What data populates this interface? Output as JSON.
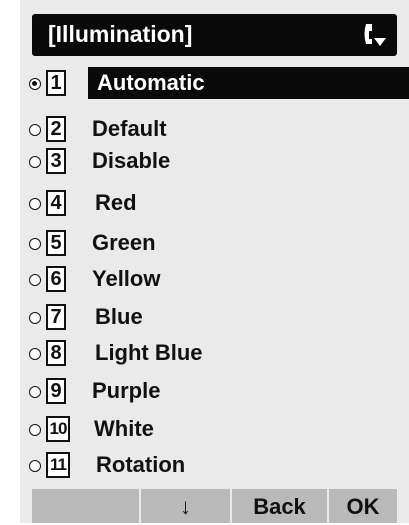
{
  "header": {
    "title": "[Illumination]",
    "icon": "handset-down-arrow-icon"
  },
  "menu": {
    "items": [
      {
        "number": "1",
        "label": "Automatic",
        "selected": true
      },
      {
        "number": "2",
        "label": "Default",
        "selected": false
      },
      {
        "number": "3",
        "label": "Disable",
        "selected": false
      },
      {
        "number": "4",
        "label": "Red",
        "selected": false
      },
      {
        "number": "5",
        "label": "Green",
        "selected": false
      },
      {
        "number": "6",
        "label": "Yellow",
        "selected": false
      },
      {
        "number": "7",
        "label": "Blue",
        "selected": false
      },
      {
        "number": "8",
        "label": "Light Blue",
        "selected": false
      },
      {
        "number": "9",
        "label": "Purple",
        "selected": false
      },
      {
        "number": "10",
        "label": "White",
        "selected": false
      },
      {
        "number": "11",
        "label": "Rotation",
        "selected": false
      }
    ]
  },
  "softkeys": [
    "",
    "↓",
    "Back",
    "OK"
  ],
  "colors": {
    "screen_bg": "#eaeaea",
    "highlight": "#0a0a0a",
    "softkey_bg": "#b9b9b9"
  }
}
